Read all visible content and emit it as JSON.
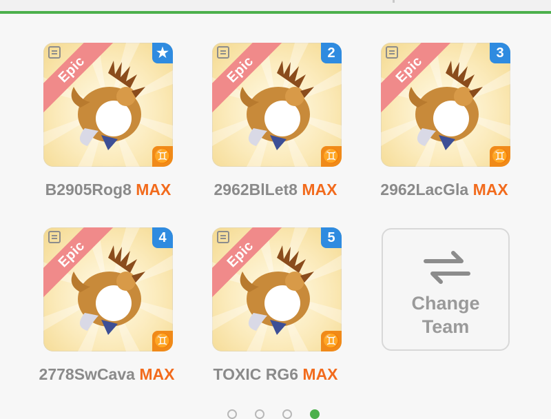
{
  "team": {
    "cards": [
      {
        "rarity": "Epic",
        "slot": "★",
        "name": "B2905Rog8",
        "level": "MAX"
      },
      {
        "rarity": "Epic",
        "slot": "2",
        "name": "2962BlLet8",
        "level": "MAX"
      },
      {
        "rarity": "Epic",
        "slot": "3",
        "name": "2962LacGla",
        "level": "MAX"
      },
      {
        "rarity": "Epic",
        "slot": "4",
        "name": "2778SwCava",
        "level": "MAX"
      },
      {
        "rarity": "Epic",
        "slot": "5",
        "name": "TOXIC RG6",
        "level": "MAX"
      }
    ],
    "element_icon": "gemini-element-icon",
    "change_team_line1": "Change",
    "change_team_line2": "Team"
  },
  "pager": {
    "pages": 4,
    "active_index": 3
  },
  "colors": {
    "accent_green": "#4cb04c",
    "epic_ribbon": "#f08a8a",
    "slot_badge": "#2f8be0",
    "element_badge": "#f08a19",
    "max_text": "#f26b1d"
  }
}
